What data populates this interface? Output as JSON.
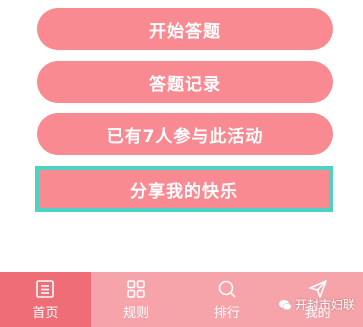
{
  "buttons": {
    "start": "开始答题",
    "record": "答题记录",
    "participants": "已有7人参与此活动",
    "share": "分享我的快乐"
  },
  "tabs": [
    {
      "label": "首页",
      "icon": "home-list-icon"
    },
    {
      "label": "规则",
      "icon": "grid-icon"
    },
    {
      "label": "排行",
      "icon": "search-icon"
    },
    {
      "label": "我的",
      "icon": "paper-plane-icon"
    }
  ],
  "watermark": "开封市妇联",
  "colors": {
    "button": "#f98a91",
    "share_border": "#4ed2c4",
    "tabbar": "#f7a3aa",
    "tab_active": "#ee6d76"
  }
}
